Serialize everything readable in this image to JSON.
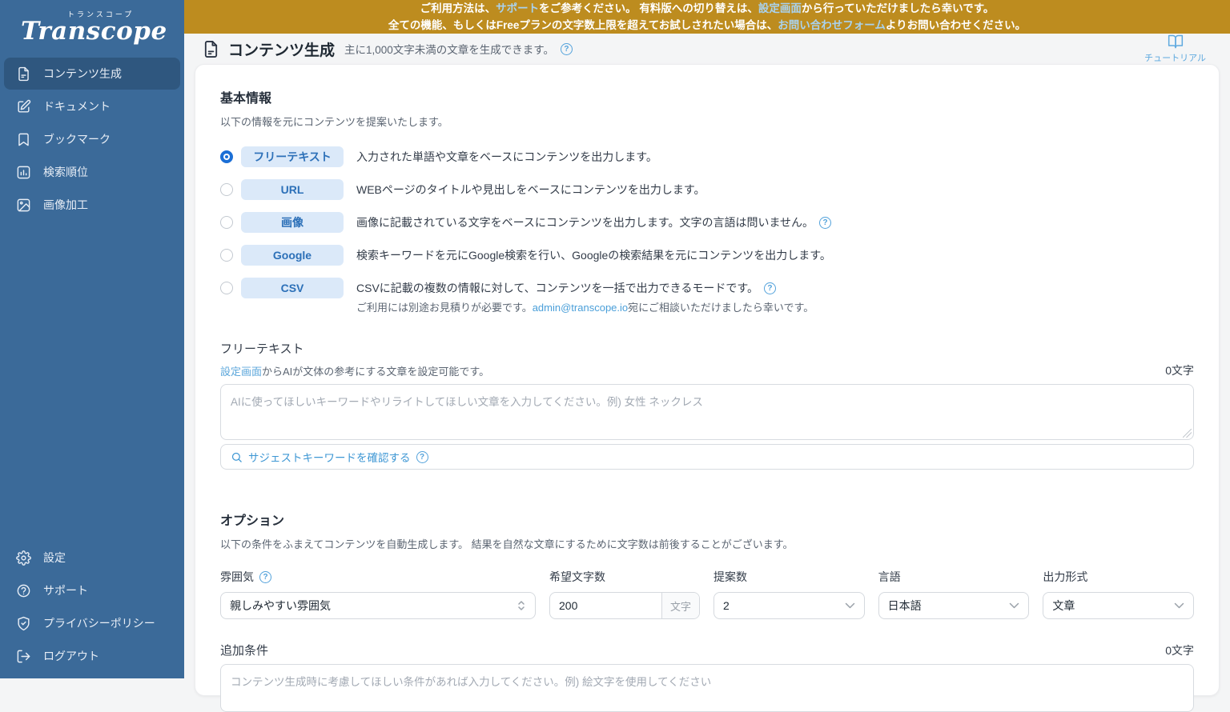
{
  "banner": {
    "line1_pre": "ご利用方法は、",
    "line1_link1": "サポート",
    "line1_mid": "をご参考ください。 有料版への切り替えは、",
    "line1_link2": "設定画面",
    "line1_post": "から行っていただけましたら幸いです。",
    "line2_pre": "全ての機能、もしくはFreeプランの文字数上限を超えてお試しされたい場合は、",
    "line2_link": "お問い合わせフォーム",
    "line2_post": "よりお問い合わせください。"
  },
  "sidebar": {
    "logo_kana": "トランスコープ",
    "logo_name": "Transcope",
    "items": [
      {
        "label": "コンテンツ生成",
        "icon": "document-icon",
        "active": true
      },
      {
        "label": "ドキュメント",
        "icon": "edit-icon",
        "active": false
      },
      {
        "label": "ブックマーク",
        "icon": "bookmark-icon",
        "active": false
      },
      {
        "label": "検索順位",
        "icon": "chart-icon",
        "active": false
      },
      {
        "label": "画像加工",
        "icon": "image-icon",
        "active": false
      }
    ],
    "footer_items": [
      {
        "label": "設定",
        "icon": "gear-icon"
      },
      {
        "label": "サポート",
        "icon": "question-icon"
      },
      {
        "label": "プライバシーポリシー",
        "icon": "shield-icon"
      },
      {
        "label": "ログアウト",
        "icon": "logout-icon"
      }
    ]
  },
  "header": {
    "title": "コンテンツ生成",
    "subtitle": "主に1,000文字未満の文章を生成できます。",
    "tutorial_label": "チュートリアル"
  },
  "basic": {
    "heading": "基本情報",
    "description": "以下の情報を元にコンテンツを提案いたします。",
    "modes": [
      {
        "label": "フリーテキスト",
        "description": "入力された単語や文章をベースにコンテンツを出力します。",
        "selected": true
      },
      {
        "label": "URL",
        "description": "WEBページのタイトルや見出しをベースにコンテンツを出力します。",
        "selected": false
      },
      {
        "label": "画像",
        "description": "画像に記載されている文字をベースにコンテンツを出力します。文字の言語は問いません。",
        "selected": false
      },
      {
        "label": "Google",
        "description": "検索キーワードを元にGoogle検索を行い、Googleの検索結果を元にコンテンツを出力します。",
        "selected": false
      },
      {
        "label": "CSV",
        "description": "CSVに記載の複数の情報に対して、コンテンツを一括で出力できるモードです。",
        "selected": false
      }
    ],
    "csv_note_pre": "ご利用には別途お見積りが必要です。",
    "csv_note_link": "admin@transcope.io",
    "csv_note_post": "宛にご相談いただけましたら幸いです。"
  },
  "free_text": {
    "label": "フリーテキスト",
    "hint_link": "設定画面",
    "hint_rest": "からAIが文体の参考にする文章を設定可能です。",
    "counter": "0文字",
    "placeholder": "AIに使ってほしいキーワードやリライトしてほしい文章を入力してください。例) 女性 ネックレス",
    "suggest_label": "サジェストキーワードを確認する"
  },
  "options": {
    "heading": "オプション",
    "description": "以下の条件をふまえてコンテンツを自動生成します。 結果を自然な文章にするために文字数は前後することがございます。",
    "fields": [
      {
        "label": "雰囲気",
        "value": "親しみやすい雰囲気"
      },
      {
        "label": "希望文字数",
        "value": "200",
        "suffix": "文字"
      },
      {
        "label": "提案数",
        "value": "2"
      },
      {
        "label": "言語",
        "value": "日本語"
      },
      {
        "label": "出力形式",
        "value": "文章"
      }
    ]
  },
  "additional": {
    "label": "追加条件",
    "counter": "0文字",
    "placeholder": "コンテンツ生成時に考慮してほしい条件があれば入力してください。例) 絵文字を使用してください"
  },
  "colors": {
    "banner_bg": "#BD8C1F",
    "banner_link": "#A9D2EE",
    "sidebar_bg": "#3B6A99",
    "sidebar_active_bg": "#2F577F",
    "accent_blue": "#2C70B8",
    "pill_bg": "#DBE9F9",
    "link_blue": "#4A9FD9",
    "radio_selected": "#1B6FD6",
    "content_bg": "#F4F5F6"
  }
}
